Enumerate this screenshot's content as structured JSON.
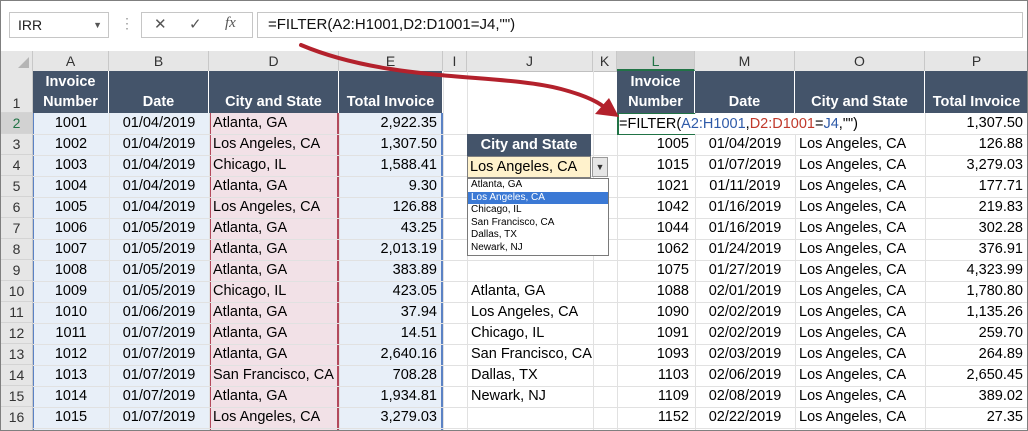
{
  "formula_bar": {
    "name_box": "IRR",
    "cancel_icon": "✕",
    "enter_icon": "✓",
    "fx_icon": "fx",
    "formula": "=FILTER(A2:H1001,D2:D1001=J4,\"\")"
  },
  "columns": [
    "A",
    "B",
    "D",
    "E",
    "I",
    "J",
    "K",
    "L",
    "M",
    "O",
    "P"
  ],
  "rows": [
    "1",
    "2",
    "3",
    "4",
    "5",
    "6",
    "7",
    "8",
    "9",
    "10",
    "11",
    "12",
    "13",
    "14",
    "15",
    "16"
  ],
  "headers": {
    "invoice_line1": "Invoice",
    "invoice_line2": "Number",
    "date": "Date",
    "city": "City and State",
    "total": "Total Invoice"
  },
  "source_table": [
    {
      "num": "1001",
      "date": "01/04/2019",
      "city": "Atlanta, GA",
      "total": "2,922.35"
    },
    {
      "num": "1002",
      "date": "01/04/2019",
      "city": "Los Angeles, CA",
      "total": "1,307.50"
    },
    {
      "num": "1003",
      "date": "01/04/2019",
      "city": "Chicago, IL",
      "total": "1,588.41"
    },
    {
      "num": "1004",
      "date": "01/04/2019",
      "city": "Atlanta, GA",
      "total": "9.30"
    },
    {
      "num": "1005",
      "date": "01/04/2019",
      "city": "Los Angeles, CA",
      "total": "126.88"
    },
    {
      "num": "1006",
      "date": "01/05/2019",
      "city": "Atlanta, GA",
      "total": "43.25"
    },
    {
      "num": "1007",
      "date": "01/05/2019",
      "city": "Atlanta, GA",
      "total": "2,013.19"
    },
    {
      "num": "1008",
      "date": "01/05/2019",
      "city": "Atlanta, GA",
      "total": "383.89"
    },
    {
      "num": "1009",
      "date": "01/05/2019",
      "city": "Chicago, IL",
      "total": "423.05"
    },
    {
      "num": "1010",
      "date": "01/06/2019",
      "city": "Atlanta, GA",
      "total": "37.94"
    },
    {
      "num": "1011",
      "date": "01/07/2019",
      "city": "Atlanta, GA",
      "total": "14.51"
    },
    {
      "num": "1012",
      "date": "01/07/2019",
      "city": "Atlanta, GA",
      "total": "2,640.16"
    },
    {
      "num": "1013",
      "date": "01/07/2019",
      "city": "San Francisco, CA",
      "total": "708.28"
    },
    {
      "num": "1014",
      "date": "01/07/2019",
      "city": "Atlanta, GA",
      "total": "1,934.81"
    },
    {
      "num": "1015",
      "date": "01/07/2019",
      "city": "Los Angeles, CA",
      "total": "3,279.03"
    }
  ],
  "criteria": {
    "header": "City and State",
    "selected": "Los Angeles, CA",
    "dropdown_options": [
      "Atlanta, GA",
      "Los Angeles, CA",
      "Chicago, IL",
      "San Francisco, CA",
      "Dallas, TX",
      "Newark, NJ"
    ],
    "list_values": [
      "Atlanta, GA",
      "Los Angeles, CA",
      "Chicago, IL",
      "San Francisco, CA",
      "Dallas, TX",
      "Newark, NJ"
    ]
  },
  "result": {
    "editing_formula": {
      "p1": "=FILTER(",
      "p2": "A2:H1001",
      "p3": ",",
      "p4": "D2:D1001",
      "p5": "=",
      "p6": "J4",
      "p7": ",\"\")"
    },
    "first_total": "1,307.50",
    "rows": [
      {
        "num": "1005",
        "date": "01/04/2019",
        "city": "Los Angeles, CA",
        "total": "126.88"
      },
      {
        "num": "1015",
        "date": "01/07/2019",
        "city": "Los Angeles, CA",
        "total": "3,279.03"
      },
      {
        "num": "1021",
        "date": "01/11/2019",
        "city": "Los Angeles, CA",
        "total": "177.71"
      },
      {
        "num": "1042",
        "date": "01/16/2019",
        "city": "Los Angeles, CA",
        "total": "219.83"
      },
      {
        "num": "1044",
        "date": "01/16/2019",
        "city": "Los Angeles, CA",
        "total": "302.28"
      },
      {
        "num": "1062",
        "date": "01/24/2019",
        "city": "Los Angeles, CA",
        "total": "376.91"
      },
      {
        "num": "1075",
        "date": "01/27/2019",
        "city": "Los Angeles, CA",
        "total": "4,323.99"
      },
      {
        "num": "1088",
        "date": "02/01/2019",
        "city": "Los Angeles, CA",
        "total": "1,780.80"
      },
      {
        "num": "1090",
        "date": "02/02/2019",
        "city": "Los Angeles, CA",
        "total": "1,135.26"
      },
      {
        "num": "1091",
        "date": "02/02/2019",
        "city": "Los Angeles, CA",
        "total": "259.70"
      },
      {
        "num": "1093",
        "date": "02/03/2019",
        "city": "Los Angeles, CA",
        "total": "264.89"
      },
      {
        "num": "1103",
        "date": "02/06/2019",
        "city": "Los Angeles, CA",
        "total": "2,650.45"
      },
      {
        "num": "1109",
        "date": "02/08/2019",
        "city": "Los Angeles, CA",
        "total": "389.02"
      },
      {
        "num": "1152",
        "date": "02/22/2019",
        "city": "Los Angeles, CA",
        "total": "27.35"
      }
    ]
  },
  "colors": {
    "header_fill": "#44546a",
    "input_fill": "#fff2cc",
    "range_blue": "#5b82c4",
    "range_red": "#b34a5c",
    "arrow": "#b3212c",
    "excel_green": "#217346"
  }
}
